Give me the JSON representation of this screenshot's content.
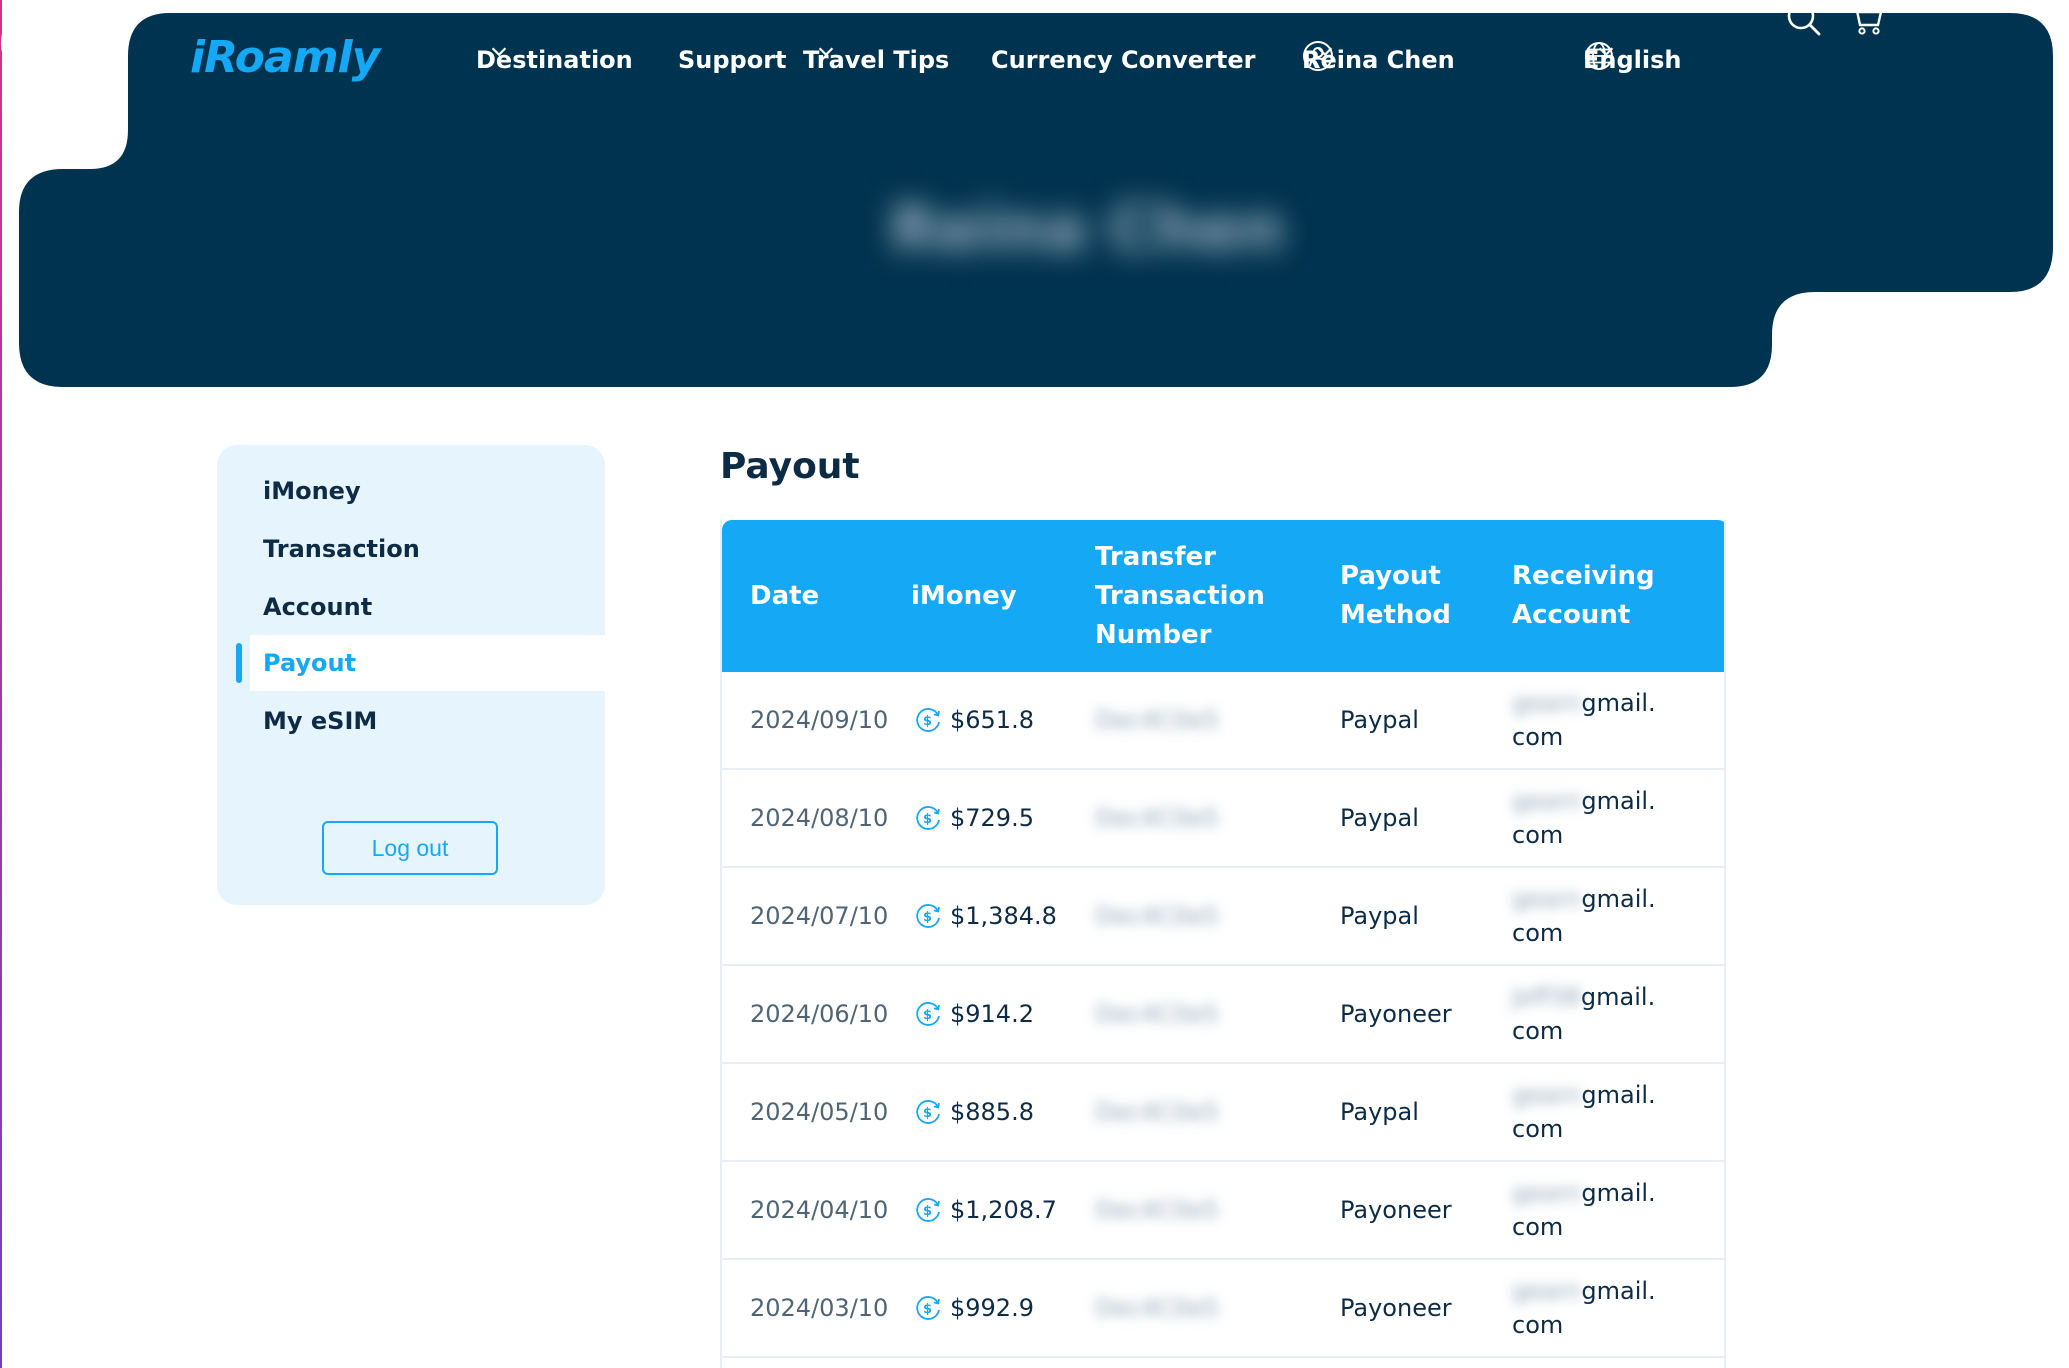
{
  "header": {
    "logo": "iRoamly",
    "nav": [
      {
        "label": "Destination",
        "has_dropdown": true
      },
      {
        "label": "Support",
        "has_dropdown": false
      },
      {
        "label": "Travel Tips",
        "has_dropdown": true
      },
      {
        "label": "Currency Converter",
        "has_dropdown": false
      }
    ],
    "user": {
      "name": "Reina Chen",
      "icon": "user-circle-icon"
    },
    "language": {
      "label": "English",
      "icon": "globe-icon"
    },
    "search_icon": "search-icon",
    "cart_icon": "cart-icon",
    "background_color": "#00334f",
    "accent_color": "#14a8f5"
  },
  "profile": {
    "name": "Reina Chen",
    "name_blurred": true,
    "avatar_icon": "user-circle-icon"
  },
  "sidebar": {
    "items": [
      {
        "label": "iMoney",
        "active": false
      },
      {
        "label": "Transaction",
        "active": false
      },
      {
        "label": "Account",
        "active": false
      },
      {
        "label": "Payout",
        "active": true
      },
      {
        "label": "My eSIM",
        "active": false
      }
    ],
    "logout_label": "Log out"
  },
  "main": {
    "title": "Payout",
    "columns": [
      "Date",
      "iMoney",
      "Transfer Transaction Number",
      "Payout Method",
      "Receiving Account"
    ],
    "rows": [
      {
        "date": "2024/09/10",
        "amount": "$651.8",
        "txn": "Dec4C0e5",
        "method": "Paypal",
        "email_user": "gearn",
        "email_domain": "gmail.",
        "email_tld": "com"
      },
      {
        "date": "2024/08/10",
        "amount": "$729.5",
        "txn": "Dec4C0e5",
        "method": "Paypal",
        "email_user": "gearn",
        "email_domain": "gmail.",
        "email_tld": "com"
      },
      {
        "date": "2024/07/10",
        "amount": "$1,384.8",
        "txn": "Dec4C0e5",
        "method": "Paypal",
        "email_user": "gearn",
        "email_domain": "gmail.",
        "email_tld": "com"
      },
      {
        "date": "2024/06/10",
        "amount": "$914.2",
        "txn": "Dec4C0e5",
        "method": "Payoneer",
        "email_user": "Jeff38",
        "email_domain": "gmail.",
        "email_tld": "com"
      },
      {
        "date": "2024/05/10",
        "amount": "$885.8",
        "txn": "Dec4C0e5",
        "method": "Paypal",
        "email_user": "gearn",
        "email_domain": "gmail.",
        "email_tld": "com"
      },
      {
        "date": "2024/04/10",
        "amount": "$1,208.7",
        "txn": "Dec4C0e5",
        "method": "Payoneer",
        "email_user": "gearn",
        "email_domain": "gmail.",
        "email_tld": "com"
      },
      {
        "date": "2024/03/10",
        "amount": "$992.9",
        "txn": "Dec4C0e5",
        "method": "Payoneer",
        "email_user": "gearn",
        "email_domain": "gmail.",
        "email_tld": "com"
      }
    ],
    "imoney_icon": "coin-dollar-icon"
  }
}
